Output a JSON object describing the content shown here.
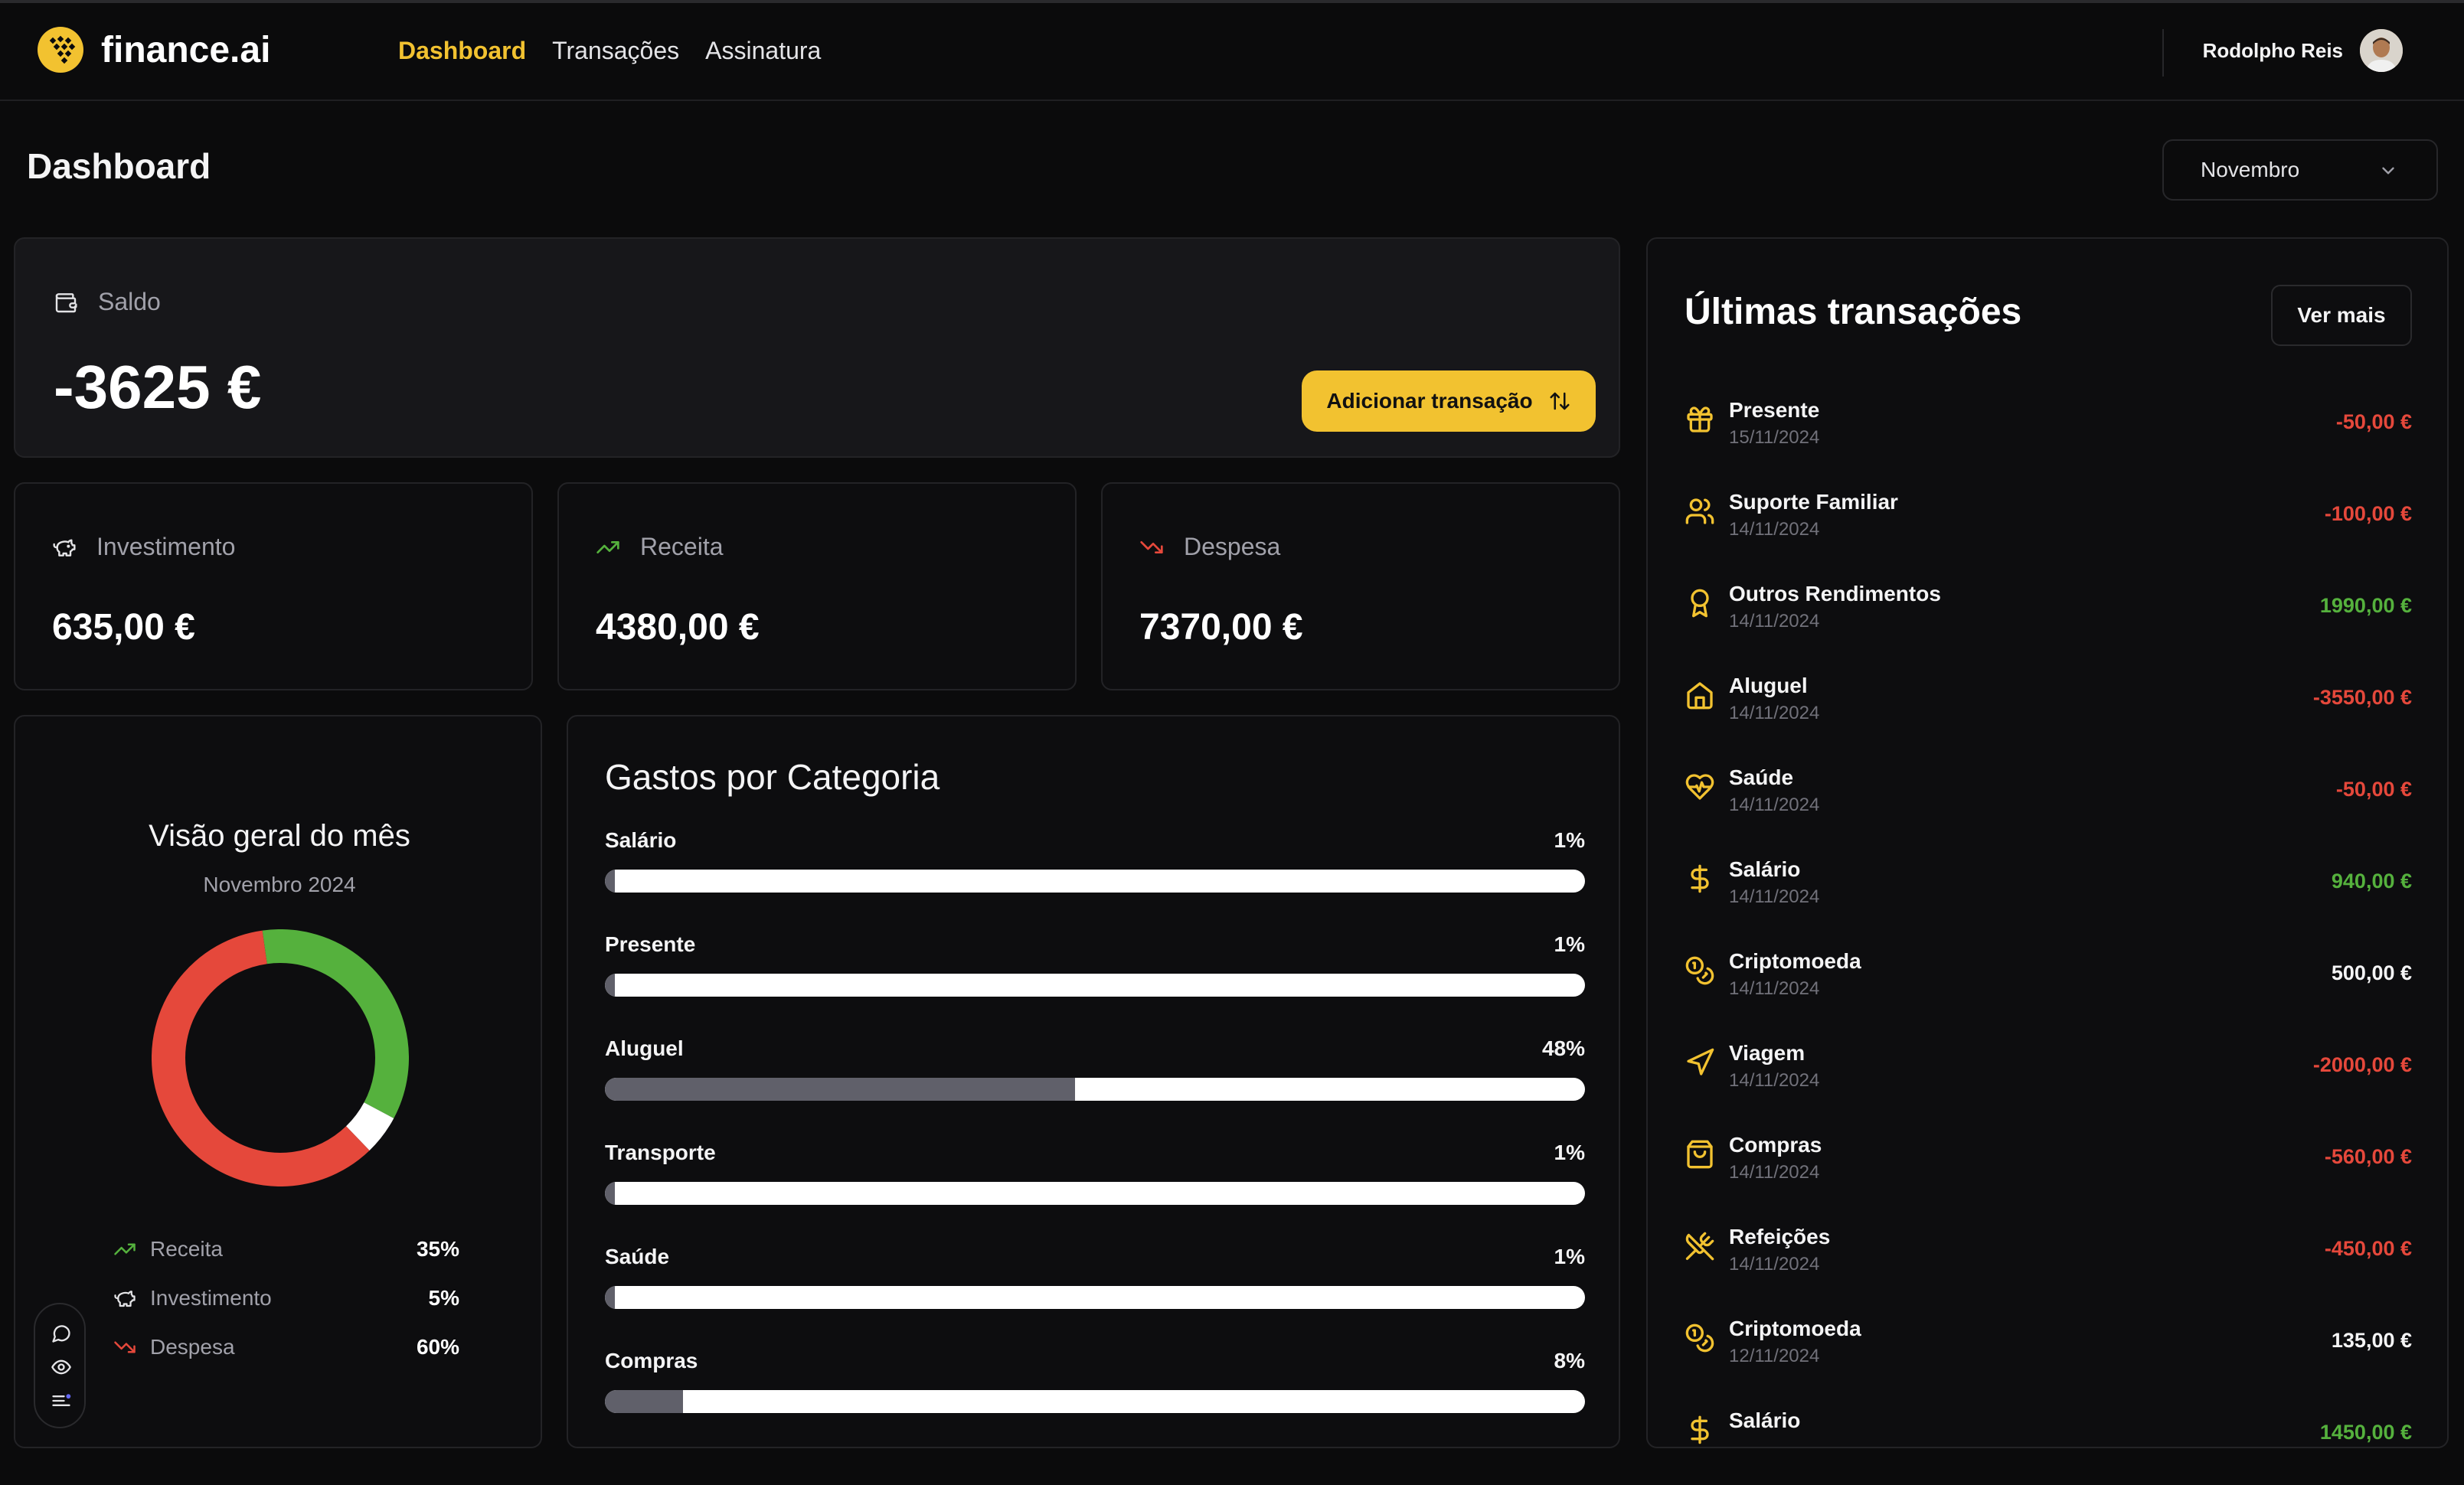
{
  "app": {
    "name": "finance.ai"
  },
  "nav": {
    "links": [
      {
        "label": "Dashboard",
        "active": true
      },
      {
        "label": "Transações",
        "active": false
      },
      {
        "label": "Assinatura",
        "active": false
      }
    ],
    "user_name": "Rodolpho Reis"
  },
  "page": {
    "title": "Dashboard",
    "month_selected": "Novembro"
  },
  "balance": {
    "label": "Saldo",
    "value": "-3625 €",
    "add_button": "Adicionar transação"
  },
  "stats": [
    {
      "label": "Investimento",
      "value": "635,00 €",
      "icon": "piggy-bank-icon"
    },
    {
      "label": "Receita",
      "value": "4380,00 €",
      "icon": "trending-up-icon"
    },
    {
      "label": "Despesa",
      "value": "7370,00 €",
      "icon": "trending-down-icon"
    }
  ],
  "overview": {
    "title": "Visão geral do mês",
    "subtitle": "Novembro  2024",
    "legend": [
      {
        "label": "Receita",
        "percent": "35%",
        "value": 35,
        "color": "#55b13d"
      },
      {
        "label": "Investimento",
        "percent": "5%",
        "value": 5,
        "color": "#ffffff"
      },
      {
        "label": "Despesa",
        "percent": "60%",
        "value": 60,
        "color": "#e5483b"
      }
    ]
  },
  "categories": {
    "title": "Gastos por Categoria",
    "items": [
      {
        "name": "Salário",
        "percent": "1%",
        "value": 1
      },
      {
        "name": "Presente",
        "percent": "1%",
        "value": 1
      },
      {
        "name": "Aluguel",
        "percent": "48%",
        "value": 48
      },
      {
        "name": "Transporte",
        "percent": "1%",
        "value": 1
      },
      {
        "name": "Saúde",
        "percent": "1%",
        "value": 1
      },
      {
        "name": "Compras",
        "percent": "8%",
        "value": 8
      }
    ]
  },
  "transactions": {
    "title": "Últimas transações",
    "see_more": "Ver mais",
    "items": [
      {
        "name": "Presente",
        "date": "15/11/2024",
        "amount": "-50,00 €",
        "type": "neg",
        "icon": "gift-icon"
      },
      {
        "name": "Suporte Familiar",
        "date": "14/11/2024",
        "amount": "-100,00 €",
        "type": "neg",
        "icon": "users-icon"
      },
      {
        "name": "Outros Rendimentos",
        "date": "14/11/2024",
        "amount": "1990,00 €",
        "type": "pos",
        "icon": "award-icon"
      },
      {
        "name": "Aluguel",
        "date": "14/11/2024",
        "amount": "-3550,00 €",
        "type": "neg",
        "icon": "house-icon"
      },
      {
        "name": "Saúde",
        "date": "14/11/2024",
        "amount": "-50,00 €",
        "type": "neg",
        "icon": "heart-pulse-icon"
      },
      {
        "name": "Salário",
        "date": "14/11/2024",
        "amount": "940,00 €",
        "type": "pos",
        "icon": "dollar-icon"
      },
      {
        "name": "Criptomoeda",
        "date": "14/11/2024",
        "amount": "500,00 €",
        "type": "neu",
        "icon": "coins-icon"
      },
      {
        "name": "Viagem",
        "date": "14/11/2024",
        "amount": "-2000,00 €",
        "type": "neg",
        "icon": "navigation-icon"
      },
      {
        "name": "Compras",
        "date": "14/11/2024",
        "amount": "-560,00 €",
        "type": "neg",
        "icon": "shopping-bag-icon"
      },
      {
        "name": "Refeições",
        "date": "14/11/2024",
        "amount": "-450,00 €",
        "type": "neg",
        "icon": "utensils-icon"
      },
      {
        "name": "Criptomoeda",
        "date": "12/11/2024",
        "amount": "135,00 €",
        "type": "neu",
        "icon": "coins-icon"
      },
      {
        "name": "Salário",
        "date": "",
        "amount": "1450,00 €",
        "type": "pos",
        "icon": "dollar-icon"
      }
    ]
  },
  "colors": {
    "accent": "#f2c230",
    "positive": "#55b13d",
    "negative": "#e5483b"
  }
}
